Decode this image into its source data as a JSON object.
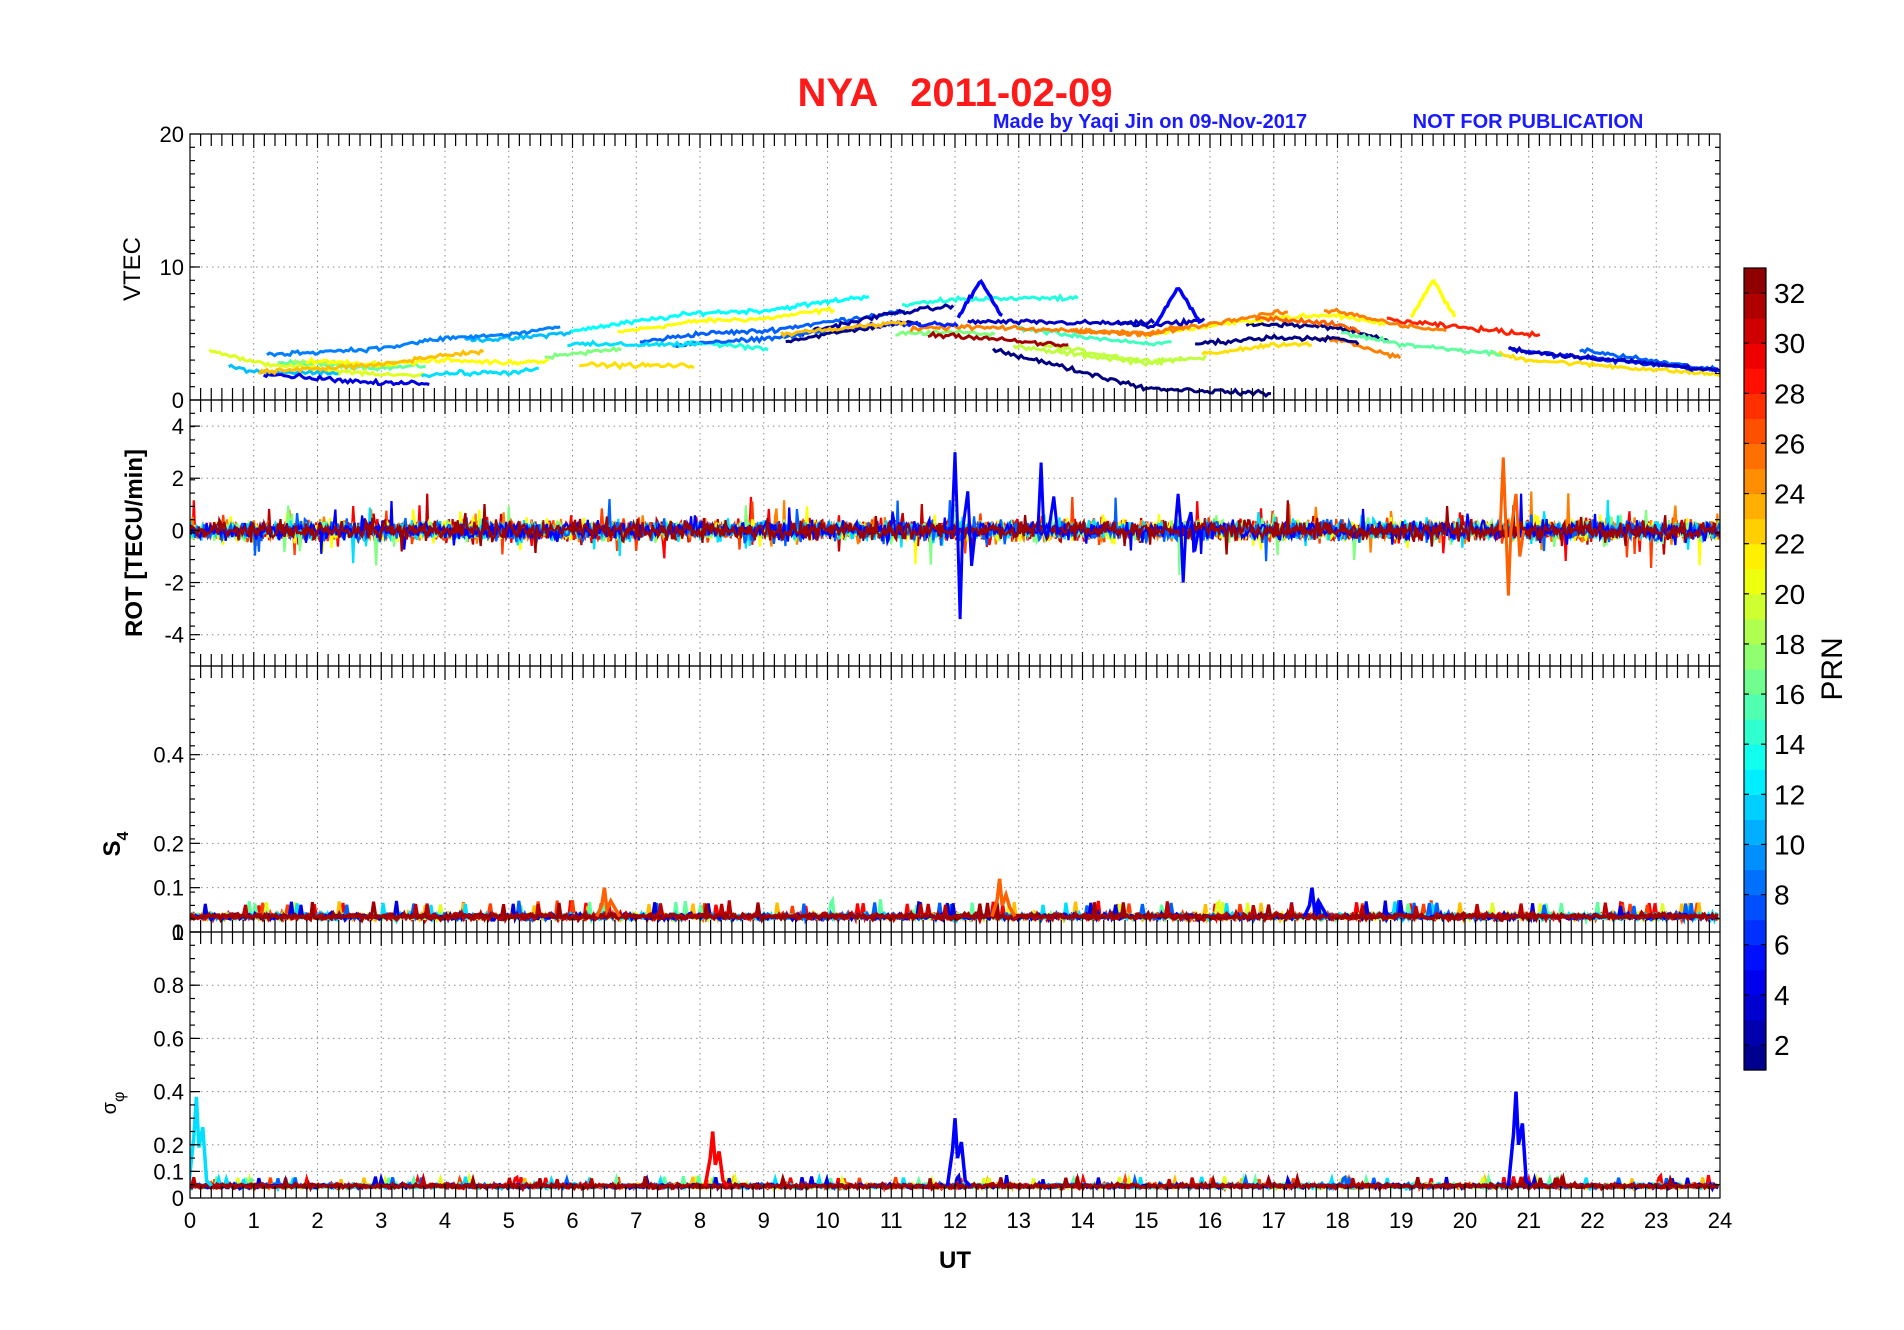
{
  "figure": {
    "title": "NYA   2011-02-09",
    "credit_author": "Made by Yaqi Jin on 09-Nov-2017",
    "credit_notice": "NOT FOR PUBLICATION",
    "title_color": "#ff1a1a",
    "credit_color": "#1a1aff"
  },
  "colorbar": {
    "label": "PRN",
    "ticks": [
      "2",
      "4",
      "6",
      "8",
      "10",
      "12",
      "14",
      "16",
      "18",
      "20",
      "22",
      "24",
      "26",
      "28",
      "30",
      "32"
    ],
    "range": [
      1,
      33
    ],
    "colormap": "jet"
  },
  "chart_data": [
    {
      "type": "line",
      "panel": "vtec",
      "ylabel": "VTEC",
      "ylim": [
        0,
        20
      ],
      "yticks": [
        "0",
        "10",
        "20"
      ],
      "xlim": [
        0,
        24
      ],
      "grid": true,
      "series_description": "VTEC traces per satellite colored by PRN, values mostly 2–8 TECU",
      "features": [
        {
          "x": [
            0,
            0.5,
            1,
            2,
            3,
            4,
            5,
            6,
            7,
            8,
            9,
            10,
            11,
            12,
            13,
            14,
            15,
            16,
            17,
            18,
            19,
            20,
            21,
            22,
            23,
            24
          ],
          "y_typical": [
            3.5,
            3,
            2.5,
            2.5,
            2.5,
            3,
            3,
            3.5,
            4,
            4.5,
            4.5,
            5,
            5.5,
            5.5,
            5,
            4.5,
            4,
            4.5,
            5,
            5,
            4,
            3.5,
            3,
            3,
            3,
            3
          ]
        },
        {
          "prn_color": "blue",
          "peak_x": 12.4,
          "peak_y": 9
        },
        {
          "prn_color": "blue",
          "peak_x": 15.5,
          "peak_y": 8.5
        },
        {
          "prn_color": "yellow",
          "peak_x": 19.5,
          "peak_y": 9
        }
      ]
    },
    {
      "type": "line",
      "panel": "rot",
      "ylabel": "ROT [TECU/min]",
      "ylim": [
        -5.2,
        5
      ],
      "yticks": [
        "-4",
        "-2",
        "0",
        "2",
        "4"
      ],
      "xlim": [
        0,
        24
      ],
      "grid": true,
      "series_description": "Rate of TEC, mostly within ±1 TECU/min",
      "spikes": [
        {
          "x": 12.0,
          "y_max": 3.0,
          "y_min": -3.4,
          "prn_color": "blue"
        },
        {
          "x": 13.35,
          "y_max": 2.6,
          "y_min": -0.2,
          "prn_color": "blue"
        },
        {
          "x": 15.5,
          "y_max": 1.4,
          "y_min": -2.0,
          "prn_color": "blue"
        },
        {
          "x": 20.6,
          "y_max": 2.8,
          "y_min": -2.5,
          "prn_color": "orange"
        }
      ]
    },
    {
      "type": "line",
      "panel": "s4",
      "ylabel": "S4",
      "ylim": [
        0,
        0.6
      ],
      "yticks": [
        "0",
        "0.1",
        "0.2",
        "0.4"
      ],
      "extra_tick_label": "1",
      "xlim": [
        0,
        24
      ],
      "grid": true,
      "series_description": "S4 amplitude scintillation index, mostly 0.02–0.06",
      "peaks": [
        {
          "x": 6.5,
          "y": 0.1,
          "prn_color": "orange"
        },
        {
          "x": 12.7,
          "y": 0.12,
          "prn_color": "orange"
        },
        {
          "x": 17.6,
          "y": 0.1,
          "prn_color": "blue"
        }
      ]
    },
    {
      "type": "line",
      "panel": "sigma_phi",
      "ylabel": "σφ",
      "ylim": [
        0,
        1
      ],
      "yticks": [
        "0",
        "0.1",
        "0.2",
        "0.4",
        "0.6",
        "0.8",
        "1"
      ],
      "xlim": [
        0,
        24
      ],
      "xlabel": "UT",
      "xticks": [
        "0",
        "1",
        "2",
        "3",
        "4",
        "5",
        "6",
        "7",
        "8",
        "9",
        "10",
        "11",
        "12",
        "13",
        "14",
        "15",
        "16",
        "17",
        "18",
        "19",
        "20",
        "21",
        "22",
        "23",
        "24"
      ],
      "grid": true,
      "series_description": "Phase scintillation index, mostly 0.02–0.08",
      "peaks": [
        {
          "x": 0.1,
          "y": 0.38,
          "prn_color": "cyan"
        },
        {
          "x": 8.2,
          "y": 0.25,
          "prn_color": "red"
        },
        {
          "x": 12.0,
          "y": 0.3,
          "prn_color": "blue"
        },
        {
          "x": 20.8,
          "y": 0.4,
          "prn_color": "blue"
        }
      ]
    }
  ]
}
